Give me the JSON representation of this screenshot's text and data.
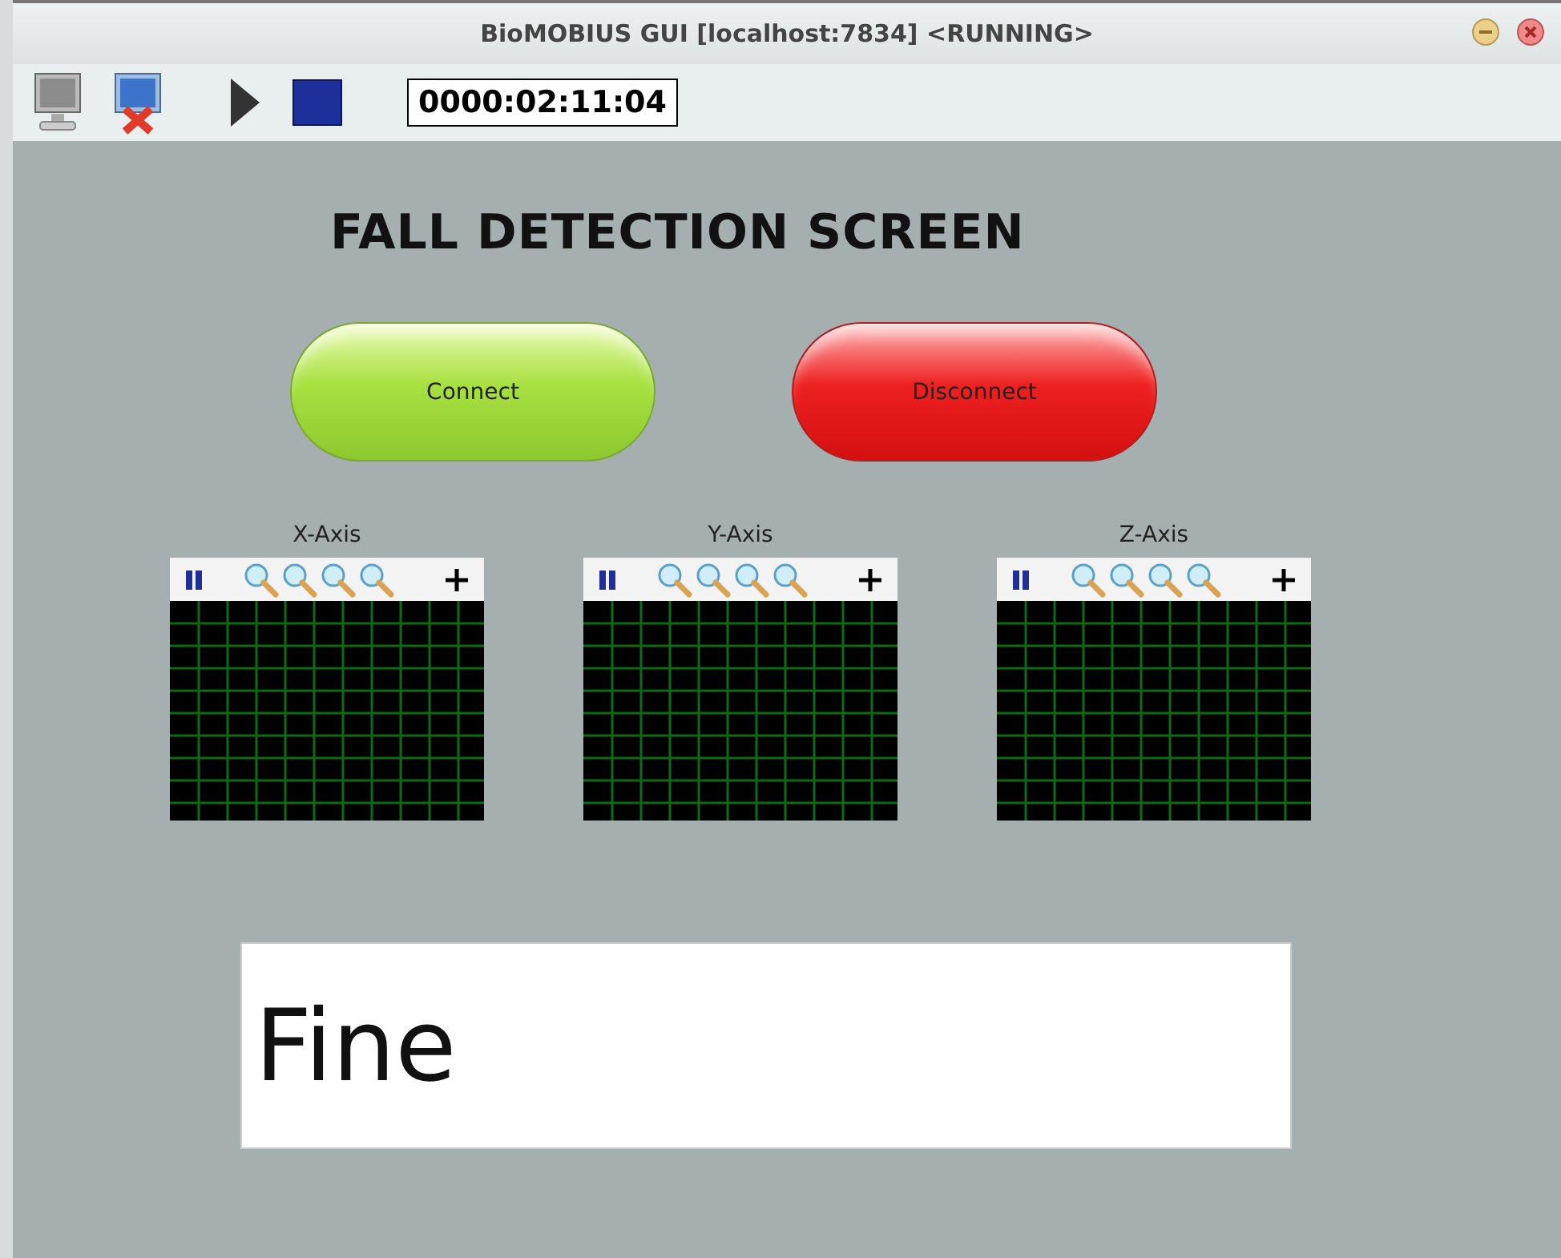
{
  "window": {
    "title": "BioMOBIUS GUI [localhost:7834] <RUNNING>"
  },
  "toolbar": {
    "timer": "0000:02:11:04"
  },
  "heading": "FALL DETECTION SCREEN",
  "buttons": [
    {
      "label": "Connect",
      "kind": "connect"
    },
    {
      "label": "Disconnect",
      "kind": "disconnect"
    }
  ],
  "plots": [
    {
      "label": "X-Axis"
    },
    {
      "label": "Y-Axis"
    },
    {
      "label": "Z-Axis"
    }
  ],
  "status": {
    "value": "Fine"
  }
}
